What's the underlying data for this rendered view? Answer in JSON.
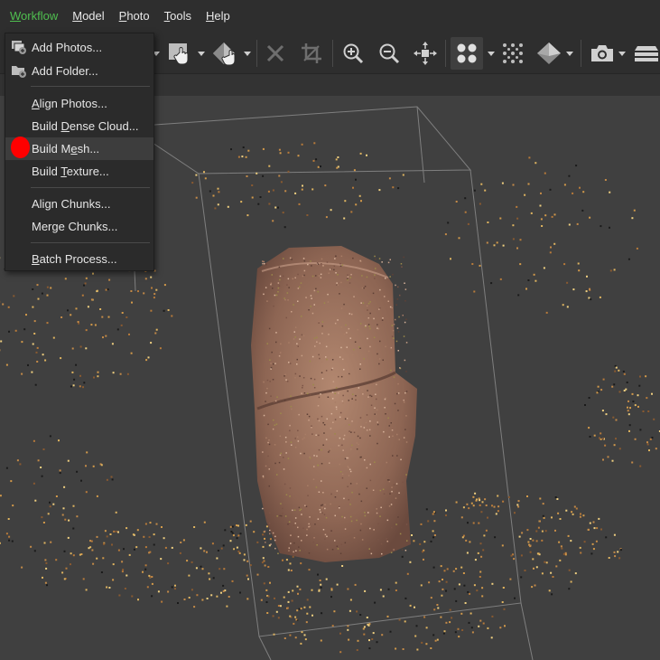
{
  "menubar": {
    "items": [
      {
        "pre": "",
        "u": "W",
        "post": "orkflow"
      },
      {
        "pre": "",
        "u": "M",
        "post": "odel"
      },
      {
        "pre": "",
        "u": "P",
        "post": "hoto"
      },
      {
        "pre": "",
        "u": "T",
        "post": "ools"
      },
      {
        "pre": "",
        "u": "H",
        "post": "elp"
      }
    ]
  },
  "workflow_menu": {
    "items": [
      {
        "pre": "Add Photos...",
        "u": "",
        "post": "",
        "icon": "add-photos-icon"
      },
      {
        "pre": "Add Folder...",
        "u": "",
        "post": "",
        "icon": "add-folder-icon"
      },
      {
        "pre": "",
        "u": "A",
        "post": "lign Photos..."
      },
      {
        "pre": "Build ",
        "u": "D",
        "post": "ense Cloud..."
      },
      {
        "pre": "Build M",
        "u": "e",
        "post": "sh..."
      },
      {
        "pre": "Build ",
        "u": "T",
        "post": "exture..."
      },
      {
        "pre": "Align Chunks...",
        "u": "",
        "post": ""
      },
      {
        "pre": "Merge Chunks...",
        "u": "",
        "post": ""
      },
      {
        "pre": "",
        "u": "B",
        "post": "atch Process..."
      }
    ]
  },
  "toolbar": {
    "icons": [
      "rectangle-select-icon",
      "navigation-icon",
      "delete-icon",
      "crop-icon",
      "zoom-in-icon",
      "zoom-out-icon",
      "reset-view-icon",
      "point-cloud-icon",
      "dense-cloud-icon",
      "model-view-icon",
      "camera-icon",
      "layers-icon"
    ]
  },
  "colors": {
    "menubar_bg": "#2e2e2e",
    "viewport_bg": "#404040",
    "active_menu": "#4fbf4f",
    "cursor_marker": "#ff0000",
    "rock": "#9a6e5a"
  }
}
